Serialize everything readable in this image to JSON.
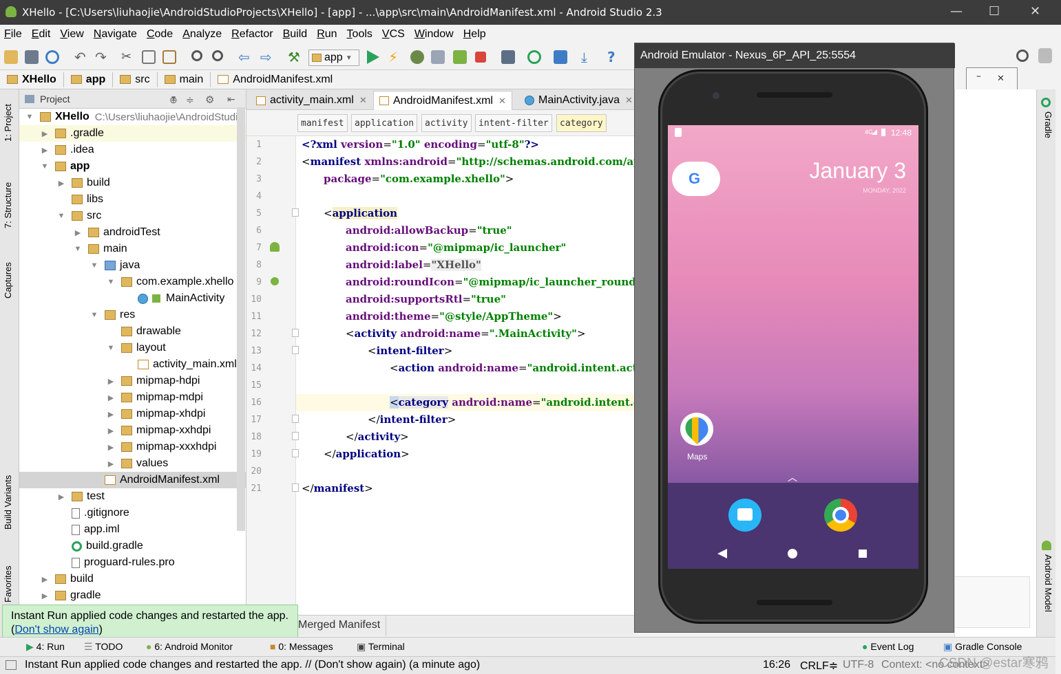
{
  "window": {
    "title": "XHello - [C:\\Users\\liuhaojie\\AndroidStudioProjects\\XHello] - [app] - ...\\app\\src\\main\\AndroidManifest.xml - Android Studio 2.3",
    "min": "—",
    "max": "☐",
    "close": "✕"
  },
  "menu": [
    "File",
    "Edit",
    "View",
    "Navigate",
    "Code",
    "Analyze",
    "Refactor",
    "Build",
    "Run",
    "Tools",
    "VCS",
    "Window",
    "Help"
  ],
  "toolbar": {
    "run_config": "app"
  },
  "breadcrumb": [
    "XHello",
    "app",
    "src",
    "main",
    "AndroidManifest.xml"
  ],
  "left_tabs": {
    "project": "1: Project",
    "structure": "7: Structure",
    "captures": "Captures",
    "build_variants": "Build Variants",
    "favorites": "Favorites"
  },
  "right_tabs": {
    "gradle": "Gradle",
    "android_model": "Android Model"
  },
  "project_panel": {
    "header": "Project",
    "root_name": "XHello",
    "root_path": "C:\\Users\\liuhaojie\\AndroidStudio",
    "items": [
      {
        "label": ".gradle"
      },
      {
        "label": ".idea"
      },
      {
        "label": "app"
      },
      {
        "label": "build"
      },
      {
        "label": "libs"
      },
      {
        "label": "src"
      },
      {
        "label": "androidTest"
      },
      {
        "label": "main"
      },
      {
        "label": "java"
      },
      {
        "label": "com.example.xhello"
      },
      {
        "label": "MainActivity"
      },
      {
        "label": "res"
      },
      {
        "label": "drawable"
      },
      {
        "label": "layout"
      },
      {
        "label": "activity_main.xml"
      },
      {
        "label": "mipmap-hdpi"
      },
      {
        "label": "mipmap-mdpi"
      },
      {
        "label": "mipmap-xhdpi"
      },
      {
        "label": "mipmap-xxhdpi"
      },
      {
        "label": "mipmap-xxxhdpi"
      },
      {
        "label": "values"
      },
      {
        "label": "AndroidManifest.xml"
      },
      {
        "label": "test"
      },
      {
        "label": ".gitignore"
      },
      {
        "label": "app.iml"
      },
      {
        "label": "build.gradle"
      },
      {
        "label": "proguard-rules.pro"
      },
      {
        "label": "build"
      },
      {
        "label": "gradle"
      }
    ]
  },
  "editor": {
    "tabs": [
      {
        "label": "activity_main.xml",
        "close": "✕"
      },
      {
        "label": "AndroidManifest.xml",
        "close": "✕"
      },
      {
        "label": "MainActivity.java",
        "close": "✕"
      }
    ],
    "xml_path": [
      "manifest",
      "application",
      "activity",
      "intent-filter",
      "category"
    ],
    "line_numbers": [
      "1",
      "2",
      "3",
      "4",
      "5",
      "6",
      "7",
      "8",
      "9",
      "10",
      "11",
      "12",
      "13",
      "14",
      "15",
      "16",
      "17",
      "18",
      "19",
      "20",
      "21"
    ],
    "bottom_tab": "Merged Manifest",
    "code": {
      "l1a": "<?xml ",
      "l1b": "version",
      "l1c": "=",
      "l1d": "\"1.0\"",
      "l1e": " encoding",
      "l1f": "=",
      "l1g": "\"utf-8\"",
      "l1h": "?>",
      "l2a": "<",
      "l2b": "manifest",
      "l2c": " xmlns:android",
      "l2d": "=",
      "l2e": "\"http://schemas.android.com/ap",
      "l3a": "package",
      "l3b": "=",
      "l3c": "\"com.example.xhello\"",
      "l3d": ">",
      "l5a": "<",
      "l5b": "application",
      "l6a": "android:",
      "l6b": "allowBackup",
      "l6c": "=",
      "l6d": "\"true\"",
      "l7a": "android:",
      "l7b": "icon",
      "l7c": "=",
      "l7d": "\"@mipmap/ic_launcher\"",
      "l8a": "android:",
      "l8b": "label",
      "l8c": "=",
      "l8d": "\"XHello\"",
      "l9a": "android:",
      "l9b": "roundIcon",
      "l9c": "=",
      "l9d": "\"@mipmap/ic_launcher_round\"",
      "l10a": "android:",
      "l10b": "supportsRtl",
      "l10c": "=",
      "l10d": "\"true\"",
      "l11a": "android:",
      "l11b": "theme",
      "l11c": "=",
      "l11d": "\"@style/AppTheme\"",
      "l11e": ">",
      "l12a": "<",
      "l12b": "activity",
      "l12c": " android:",
      "l12d": "name",
      "l12e": "=",
      "l12f": "\".MainActivity\"",
      "l12g": ">",
      "l13a": "<",
      "l13b": "intent-filter",
      "l13c": ">",
      "l14a": "<",
      "l14b": "action",
      "l14c": " android:",
      "l14d": "name",
      "l14e": "=",
      "l14f": "\"android.intent.act",
      "l16a": "<",
      "l16b": "category",
      "l16c": " android:",
      "l16d": "name",
      "l16e": "=",
      "l16f": "\"android.intent.c",
      "l17a": "</",
      "l17b": "intent-filter",
      "l17c": ">",
      "l18a": "</",
      "l18b": "activity",
      "l18c": ">",
      "l19a": "</",
      "l19b": "application",
      "l19c": ">",
      "l21a": "</",
      "l21b": "manifest",
      "l21c": ">"
    }
  },
  "emulator": {
    "title": "Android Emulator - Nexus_6P_API_25:5554",
    "clock": "12:48",
    "network": "4G",
    "date_big": "January 3",
    "date_small": "MONDAY, 2022",
    "maps_label": "Maps",
    "side_min": "–",
    "side_close": "✕"
  },
  "toast": {
    "text": "Instant Run applied code changes and restarted the app.",
    "link": "Don't show again"
  },
  "bottom_tabs": [
    {
      "label": "4: Run"
    },
    {
      "label": "TODO"
    },
    {
      "label": "6: Android Monitor"
    },
    {
      "label": "0: Messages"
    },
    {
      "label": "Terminal"
    },
    {
      "label": "Event Log"
    },
    {
      "label": "Gradle Console"
    }
  ],
  "status": {
    "message": "Instant Run applied code changes and restarted the app. // (Don't show again) (a minute ago)",
    "position": "16:26",
    "line_sep": "CRLF≑",
    "encoding": "UTF-8",
    "context": "Context: <no context>",
    "watermark": "CSDN @estar寒鸦"
  },
  "colors": {
    "tag": "#000080",
    "attribute": "#660e7a",
    "value": "#008000",
    "toast_bg": "#d0f0d0",
    "android_green": "#7cb342"
  }
}
